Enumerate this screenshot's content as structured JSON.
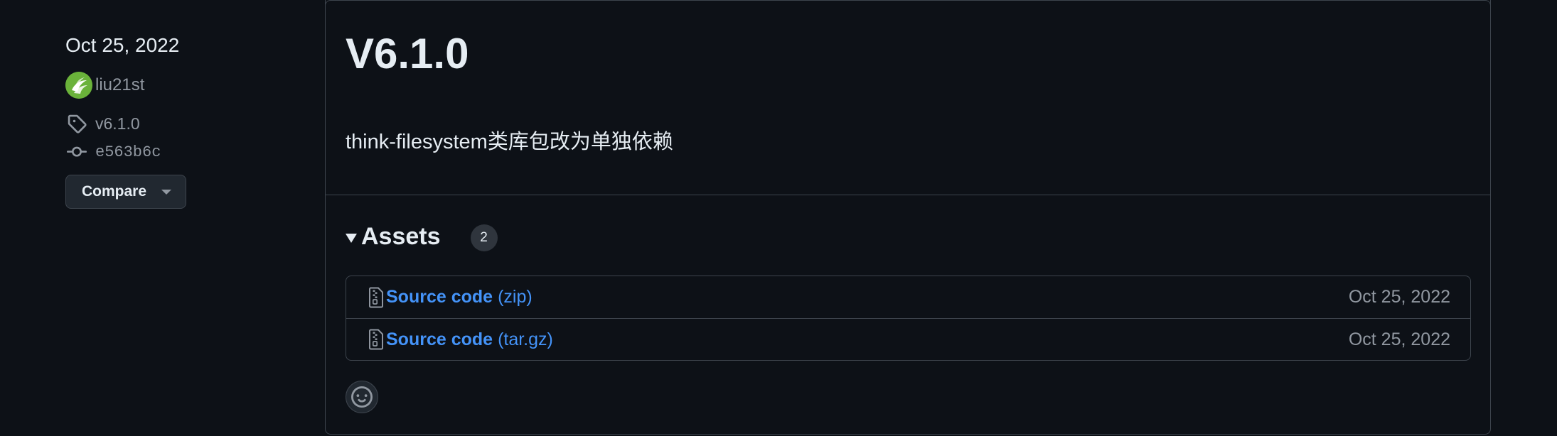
{
  "sidebar": {
    "date": "Oct 25, 2022",
    "author": "liu21st",
    "tag": "v6.1.0",
    "commit": "e563b6c",
    "compare_label": "Compare"
  },
  "release": {
    "title": "V6.1.0",
    "body": "think-filesystem类库包改为单独依赖",
    "assets": {
      "label": "Assets",
      "count": "2",
      "items": [
        {
          "name": "Source code",
          "ext": "(zip)",
          "date": "Oct 25, 2022"
        },
        {
          "name": "Source code",
          "ext": "(tar.gz)",
          "date": "Oct 25, 2022"
        }
      ]
    }
  },
  "icons": {
    "avatar": "avatar-logo",
    "tag": "tag-icon",
    "commit": "commit-icon",
    "file_zip": "file-zip-icon",
    "emoji": "smiley-icon"
  },
  "colors": {
    "background": "#0d1117",
    "border": "#3d444d",
    "link": "#4493f8",
    "muted": "#9198a1",
    "text": "#e6edf3"
  }
}
